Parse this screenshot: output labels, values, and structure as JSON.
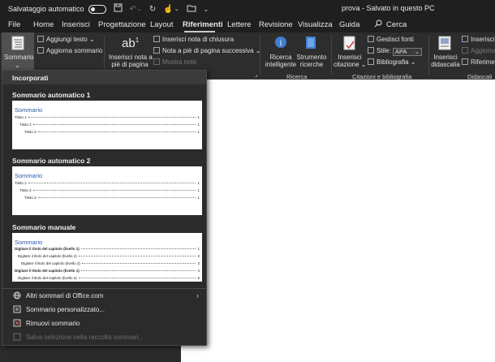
{
  "titlebar": {
    "autosave_label": "Salvataggio automatico",
    "document_status": "prova  -  Salvato in questo PC"
  },
  "menu": {
    "tabs": [
      {
        "label": "File"
      },
      {
        "label": "Home"
      },
      {
        "label": "Inserisci"
      },
      {
        "label": "Progettazione"
      },
      {
        "label": "Layout"
      },
      {
        "label": "Riferimenti"
      },
      {
        "label": "Lettere"
      },
      {
        "label": "Revisione"
      },
      {
        "label": "Visualizza"
      },
      {
        "label": "Guida"
      }
    ],
    "active_tab": "Riferimenti",
    "search_label": "Cerca"
  },
  "ribbon": {
    "sommario": "Sommario",
    "aggiungi_testo": "Aggiungi testo",
    "aggiorna_sommario": "Aggiorna sommario",
    "inserisci_nota_line1": "Inserisci nota a",
    "inserisci_nota_line2": "piè di pagina",
    "inserisci_nota_chiusura": "Inserisci nota di chiusura",
    "nota_successiva": "Nota a piè di pagina successiva",
    "mostra_note": "Mostra note",
    "ricerca_intelligente_line1": "Ricerca",
    "ricerca_intelligente_line2": "intelligente",
    "strumento_ricerche_line1": "Strumento",
    "strumento_ricerche_line2": "ricerche",
    "ricerca_group": "Ricerca",
    "inserisci_citazione_line1": "Inserisci",
    "inserisci_citazione_line2": "citazione",
    "gestisci_fonti": "Gestisci fonti",
    "stile_label": "Stile:",
    "stile_value": "APA",
    "bibliografia": "Bibliografia",
    "citazioni_group": "Citazioni e bibliografia",
    "inserisci_didascalia_line1": "Inserisci",
    "inserisci_didascalia_line2": "didascalia",
    "inserisci_indice": "Inserisci",
    "aggiorna": "Aggiorna",
    "riferimento": "Riferimen",
    "didascalie_group": "Didascali"
  },
  "gallery": {
    "header": "Incorporati",
    "auto1": {
      "title": "Sommario automatico 1",
      "heading": "Sommario",
      "lines": [
        {
          "text": "Titolo 1",
          "page": "1",
          "level": 1
        },
        {
          "text": "Titolo 2",
          "page": "1",
          "level": 2
        },
        {
          "text": "Titolo 3",
          "page": "1",
          "level": 3
        }
      ]
    },
    "auto2": {
      "title": "Sommario automatico 2",
      "heading": "Sommario",
      "lines": [
        {
          "text": "Titolo 1",
          "page": "1",
          "level": 1
        },
        {
          "text": "Titolo 2",
          "page": "1",
          "level": 2
        },
        {
          "text": "Titolo 3",
          "page": "1",
          "level": 3
        }
      ]
    },
    "manual": {
      "title": "Sommario manuale",
      "heading": "Sommario",
      "lines": [
        {
          "text": "Digitare il titolo del capitolo (livello 1)",
          "page": "1",
          "level": 1
        },
        {
          "text": "Digitare il titolo del capitolo (livello 2)",
          "page": "2",
          "level": 2
        },
        {
          "text": "Digitare il titolo del capitolo (livello 3)",
          "page": "3",
          "level": 3
        },
        {
          "text": "Digitare il titolo del capitolo (livello 1)",
          "page": "4",
          "level": 1
        },
        {
          "text": "Digitare il titolo del capitolo (livello 2)",
          "page": "5",
          "level": 2
        }
      ]
    },
    "menu_items": [
      {
        "label": "Altri sommari di Office.com",
        "icon": "globe-icon",
        "has_submenu": true,
        "enabled": true
      },
      {
        "label": "Sommario personalizzato...",
        "icon": "custom-toc-icon",
        "has_submenu": false,
        "enabled": true
      },
      {
        "label": "Rimuovi sommario",
        "icon": "remove-toc-icon",
        "has_submenu": false,
        "enabled": true
      },
      {
        "label": "Salva selezione nella raccolta sommari...",
        "icon": "save-selection-icon",
        "has_submenu": false,
        "enabled": false
      }
    ]
  },
  "colors": {
    "accent_blue": "#2e5aa6",
    "dark_bg": "#2b2b2b",
    "ribbon_bg": "#2d2d2d"
  }
}
